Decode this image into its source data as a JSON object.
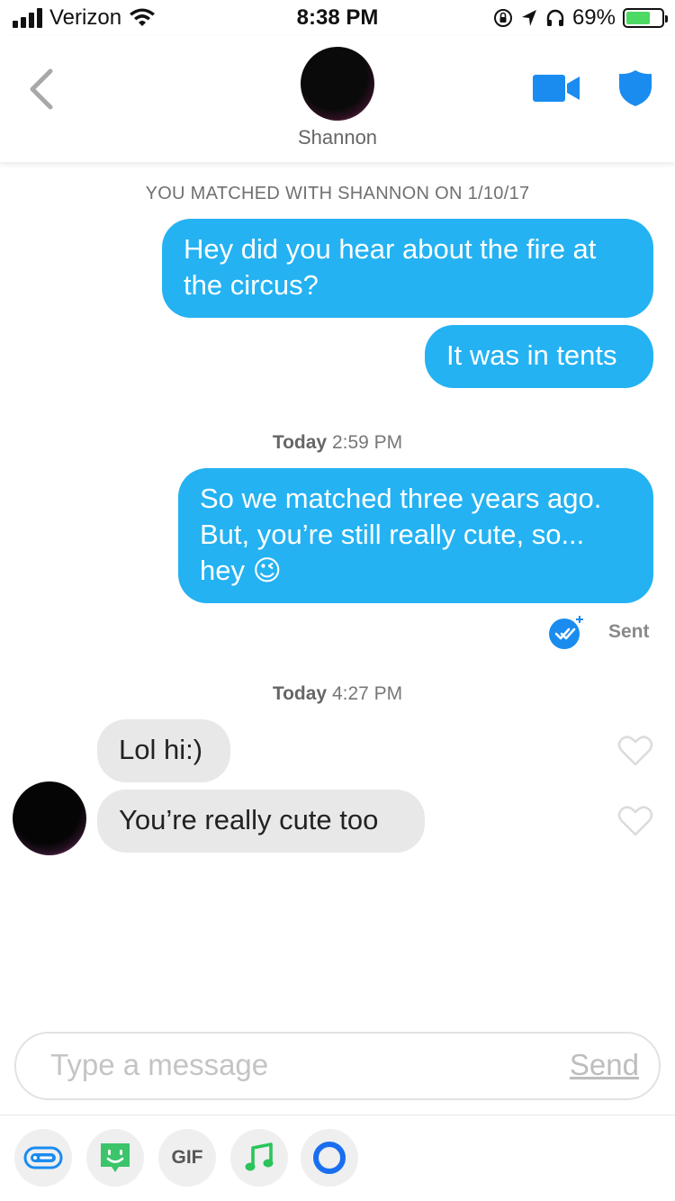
{
  "status_bar": {
    "carrier": "Verizon",
    "time": "8:38 PM",
    "battery": "69%",
    "battery_level": 0.69
  },
  "header": {
    "name": "Shannon",
    "icons": [
      "back-chevron-icon",
      "video-camera-icon",
      "shield-icon"
    ]
  },
  "chat": {
    "match_banner": "YOU MATCHED WITH SHANNON ON 1/10/17",
    "messages_1": [
      "Hey did you hear about the fire at the circus?",
      "It was in tents"
    ],
    "timestamp_1": {
      "day": "Today",
      "time": "2:59 PM"
    },
    "message_2_line1": "So we matched three years ago.",
    "message_2_line2": "But, you’re still really cute, so...",
    "message_2_line3": "hey",
    "message_2_emoji": "😉",
    "status": "Sent",
    "timestamp_2": {
      "day": "Today",
      "time": "4:27 PM"
    },
    "incoming": [
      "Lol hi:)",
      "You’re really cute too"
    ]
  },
  "composer": {
    "placeholder": "Type a message",
    "send_label": "Send"
  },
  "toolbar": {
    "gif_label": "GIF",
    "icons": [
      "sticker-card-icon",
      "bitmoji-icon",
      "gif-icon",
      "music-note-icon",
      "loop-ring-icon"
    ]
  },
  "colors": {
    "outgoing_bubble": "#24b2f2",
    "incoming_bubble": "#e8e8e8",
    "accent_blue": "#1a8cf0"
  }
}
